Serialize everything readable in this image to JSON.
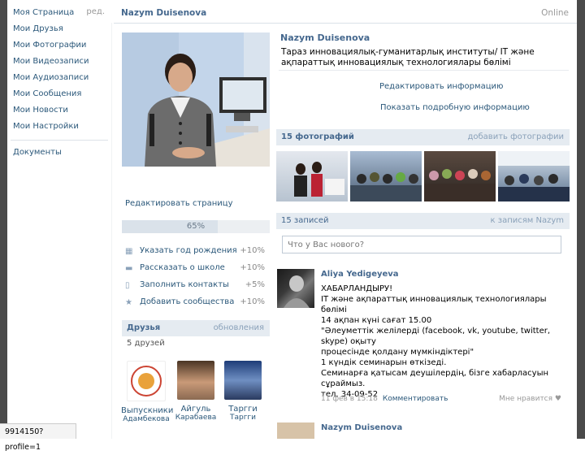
{
  "sidebar": {
    "items": [
      "Моя Страница",
      "Мои Друзья",
      "Мои Фотографии",
      "Мои Видеозаписи",
      "Мои Аудиозаписи",
      "Мои Сообщения",
      "Мои Новости",
      "Мои Настройки"
    ],
    "edit_label": "ред.",
    "documents": "Документы"
  },
  "header": {
    "name": "Nazym Duisenova",
    "online": "Online"
  },
  "profile": {
    "name": "Nazym Duisenova",
    "status": "Тараз инновациялық-гуманитарлық институты/ IT және ақпараттық инновациялық технологиялары бөлімі",
    "edit_info": "Редактировать информацию",
    "show_details": "Показать подробную информацию",
    "edit_page": "Редактировать страницу",
    "progress_percent": 65,
    "progress_label": "65%"
  },
  "tips": [
    {
      "icon": "gift-icon",
      "label": "Указать год рождения",
      "value": "+10%"
    },
    {
      "icon": "school-icon",
      "label": "Рассказать о школе",
      "value": "+10%"
    },
    {
      "icon": "phone-icon",
      "label": "Заполнить контакты",
      "value": "+5%"
    },
    {
      "icon": "star-icon",
      "label": "Добавить сообщества",
      "value": "+10%"
    }
  ],
  "friends": {
    "title": "Друзья",
    "updates": "обновления",
    "count": "5 друзей",
    "list": [
      {
        "first": "Выпускники",
        "last": "Адамбекова"
      },
      {
        "first": "Айгуль",
        "last": "Карабаева"
      },
      {
        "first": "Таргги",
        "last": "Таргги"
      }
    ]
  },
  "photos": {
    "title": "15 фотографий",
    "add": "добавить фотографии"
  },
  "wall": {
    "title": "15 записей",
    "link": "к записям Nazym",
    "placeholder": "Что у Вас нового?",
    "post": {
      "author": "Aliya Yedigeyeva",
      "text": "ХАБАРЛАНДЫРУ!\nIT және ақпараттық инновациялық технологиялары бөлімі\n14 ақпан күні сағат 15.00\n\"Әлеуметтік желілерді (facebook, vk, youtube, twitter, skype) оқыту\nпроцесінде қолдану мүмкіндіктері\"\n1 күндік семинарын өткізеді.\nСеминарға қатысам деушілердің, бізге хабарласуын сұраймыз.\nтел. 34-09-52",
      "date": "11 фев в 15:18",
      "comment": "Комментировать",
      "like": "Мне нравится"
    },
    "post2_author": "Nazym Duisenova"
  },
  "statusbar": {
    "url": "9914150?profile=1"
  },
  "colors": {
    "link": "#2b587a",
    "header_bg": "#e5ebf1",
    "name": "#45688e"
  }
}
